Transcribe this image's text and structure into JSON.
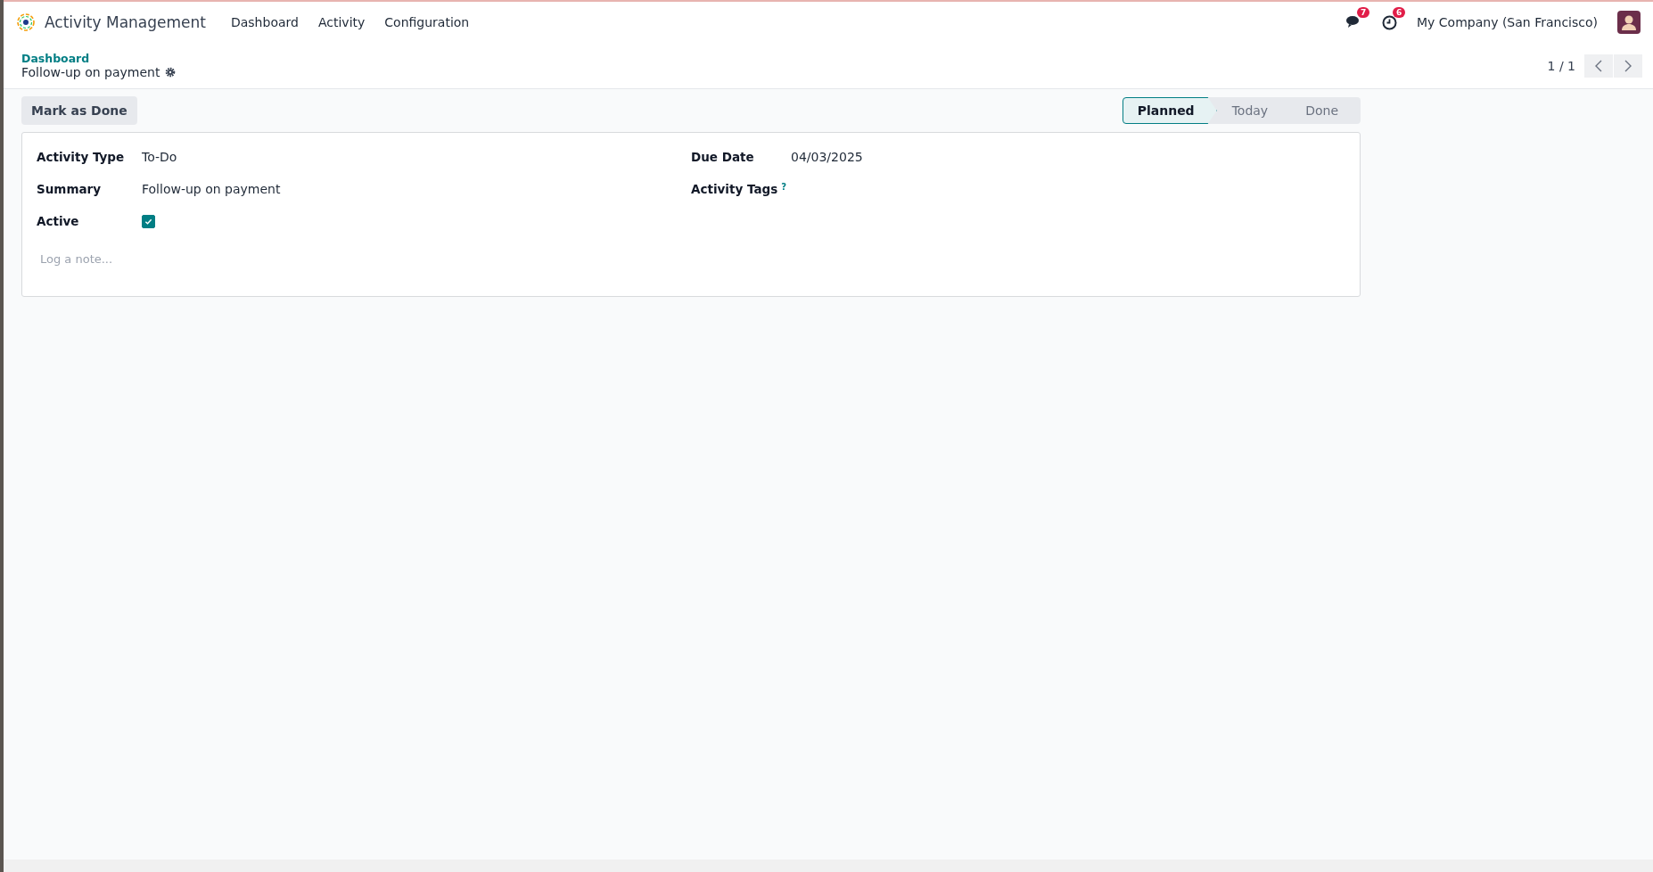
{
  "navbar": {
    "app_name": "Activity Management",
    "menu": [
      "Dashboard",
      "Activity",
      "Configuration"
    ],
    "messages_count": "7",
    "activities_count": "6",
    "company": "My Company (San Francisco)"
  },
  "breadcrumb": {
    "parent": "Dashboard",
    "current": "Follow-up on payment"
  },
  "pager": {
    "value": "1 / 1"
  },
  "actions": {
    "mark_done": "Mark as Done"
  },
  "stages": [
    {
      "label": "Planned",
      "selected": true
    },
    {
      "label": "Today",
      "selected": false
    },
    {
      "label": "Done",
      "selected": false
    }
  ],
  "form": {
    "left": [
      {
        "kind": "text",
        "label": "Activity Type",
        "value": "To-Do"
      },
      {
        "kind": "text",
        "label": "Summary",
        "value": "Follow-up on payment"
      },
      {
        "kind": "checkbox",
        "label": "Active",
        "checked": true
      }
    ],
    "right": [
      {
        "kind": "text",
        "label": "Due Date",
        "value": "04/03/2025"
      },
      {
        "kind": "tags",
        "label": "Activity Tags",
        "help": "?"
      }
    ],
    "note": {
      "placeholder": "Log a note..."
    }
  }
}
